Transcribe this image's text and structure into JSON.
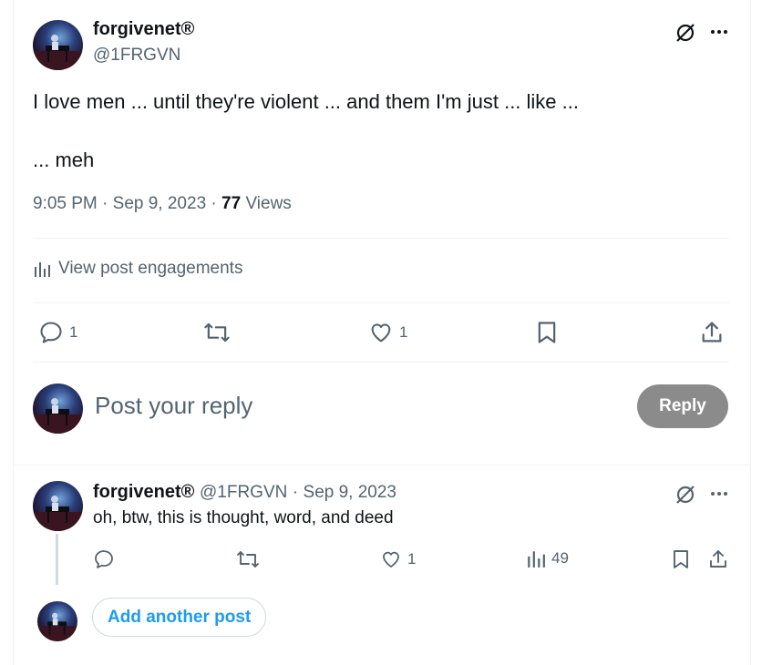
{
  "colors": {
    "accent": "#1d9bf0",
    "muted": "#536471",
    "text": "#0f1419",
    "reply_button_disabled": "#8b8b8b"
  },
  "post": {
    "author_name": "forgivenet®",
    "author_handle": "@1FRGVN",
    "text": "I love men ... until they're violent ... and them I'm just ... like ...\n\n... meh",
    "time": "9:05 PM",
    "date": "Sep 9, 2023",
    "views_count": "77",
    "views_label": "Views",
    "engagements_label": "View post engagements",
    "actions": {
      "replies": "1",
      "reposts": "",
      "likes": "1"
    }
  },
  "composer": {
    "placeholder": "Post your reply",
    "reply_label": "Reply"
  },
  "reply": {
    "author_name": "forgivenet®",
    "author_handle": "@1FRGVN",
    "date": "Sep 9, 2023",
    "text": "oh, btw, this is thought, word, and deed",
    "actions": {
      "replies": "",
      "reposts": "",
      "likes": "1",
      "views": "49"
    }
  },
  "add_another_label": "Add another post",
  "icons": [
    "grok-icon",
    "more-icon",
    "analytics-icon",
    "reply-icon",
    "repost-icon",
    "like-icon",
    "bookmark-icon",
    "share-icon"
  ]
}
